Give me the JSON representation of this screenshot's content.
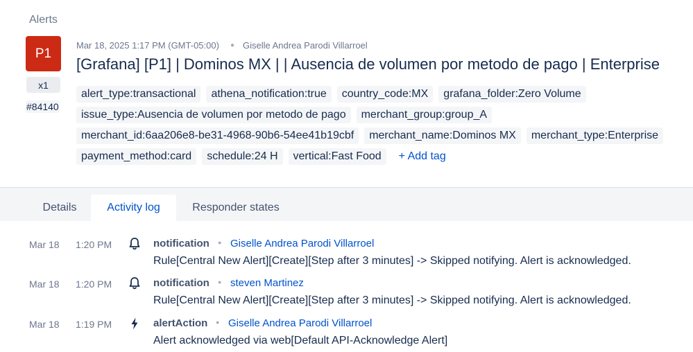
{
  "breadcrumb": "Alerts",
  "alert": {
    "priority": "P1",
    "count": "x1",
    "id": "#84140",
    "timestamp": "Mar 18, 2025 1:17 PM (GMT-05:00)",
    "owner": "Giselle Andrea Parodi Villarroel",
    "title": "[Grafana] [P1] | Dominos MX | | Ausencia de volumen por metodo de pago | Enterprise",
    "priority_color": "#cc2a14"
  },
  "tags": {
    "row1": [
      "alert_type:transactional",
      "athena_notification:true",
      "country_code:MX",
      "grafana_folder:Zero Volume"
    ],
    "row2": [
      "issue_type:Ausencia de volumen por metodo de pago",
      "merchant_group:group_A"
    ],
    "row3": [
      "merchant_id:6aa206e8-be31-4968-90b6-54ee41b19cbf",
      "merchant_name:Dominos MX",
      "merchant_type:Enterprise"
    ],
    "row4": [
      "payment_method:card",
      "schedule:24 H",
      "vertical:Fast Food"
    ],
    "add_label": "+ Add tag"
  },
  "tabs": [
    {
      "label": "Details",
      "active": false
    },
    {
      "label": "Activity log",
      "active": true
    },
    {
      "label": "Responder states",
      "active": false
    }
  ],
  "activity": [
    {
      "date": "Mar 18",
      "time": "1:20 PM",
      "icon": "bell-icon",
      "type": "notification",
      "user": "Giselle Andrea Parodi Villarroel",
      "message": "Rule[Central New Alert][Create][Step after 3 minutes] -> Skipped notifying. Alert is acknowledged."
    },
    {
      "date": "Mar 18",
      "time": "1:20 PM",
      "icon": "bell-icon",
      "type": "notification",
      "user": "steven Martinez",
      "message": "Rule[Central New Alert][Create][Step after 3 minutes] -> Skipped notifying. Alert is acknowledged."
    },
    {
      "date": "Mar 18",
      "time": "1:19 PM",
      "icon": "lightning-icon",
      "type": "alertAction",
      "user": "Giselle Andrea Parodi Villarroel",
      "message": "Alert acknowledged via web[Default API-Acknowledge Alert]"
    }
  ],
  "colors": {
    "accent": "#0052cc",
    "tab_bar": "#f4f5f7",
    "tag_bg": "#f4f5f7"
  }
}
